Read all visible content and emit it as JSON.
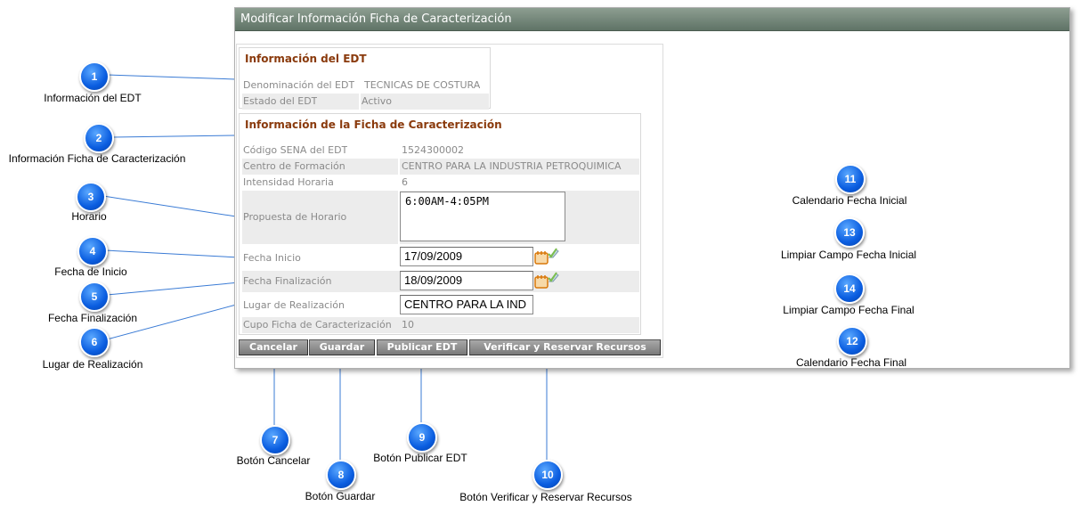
{
  "window": {
    "title": "Modificar Información Ficha de Caracterización"
  },
  "edt_section": {
    "title": "Información del EDT",
    "rows": [
      {
        "label": "Denominación del EDT",
        "value": "TECNICAS DE COSTURA"
      },
      {
        "label": "Estado del EDT",
        "value": "Activo"
      }
    ]
  },
  "ficha_section": {
    "title": "Información de la Ficha de Caracterización",
    "codigo": {
      "label": "Código SENA del EDT",
      "value": "1524300002"
    },
    "centro": {
      "label": "Centro de Formación",
      "value": "CENTRO PARA LA INDUSTRIA PETROQUIMICA"
    },
    "intensidad": {
      "label": "Intensidad Horaria",
      "value": "6"
    },
    "horario": {
      "label": "Propuesta de Horario",
      "value": "6:00AM-4:05PM"
    },
    "fecha_inicio": {
      "label": "Fecha Inicio",
      "value": "17/09/2009"
    },
    "fecha_fin": {
      "label": "Fecha Finalización",
      "value": "18/09/2009"
    },
    "lugar": {
      "label": "Lugar de Realización",
      "value": "CENTRO PARA LA IND"
    },
    "cupo": {
      "label": "Cupo Ficha de Caracterización",
      "value": "10"
    }
  },
  "buttons": {
    "cancelar": "Cancelar",
    "guardar": "Guardar",
    "publicar": "Publicar EDT",
    "verificar": "Verificar y Reservar Recursos"
  },
  "annotations": [
    {
      "num": "1",
      "caption": "Información del EDT"
    },
    {
      "num": "2",
      "caption": "Información Ficha de Caracterización"
    },
    {
      "num": "3",
      "caption": "Horario"
    },
    {
      "num": "4",
      "caption": "Fecha de Inicio"
    },
    {
      "num": "5",
      "caption": "Fecha Finalización"
    },
    {
      "num": "6",
      "caption": "Lugar de Realización"
    },
    {
      "num": "7",
      "caption": "Botón Cancelar"
    },
    {
      "num": "8",
      "caption": "Botón Guardar"
    },
    {
      "num": "9",
      "caption": "Botón Publicar EDT"
    },
    {
      "num": "10",
      "caption": "Botón Verificar y Reservar Recursos"
    },
    {
      "num": "11",
      "caption": "Calendario Fecha Inicial"
    },
    {
      "num": "12",
      "caption": "Calendario Fecha Final"
    },
    {
      "num": "13",
      "caption": "Limpiar Campo Fecha Inicial"
    },
    {
      "num": "14",
      "caption": "Limpiar Campo Fecha Final"
    }
  ],
  "icons": {
    "calendar": "calendar-icon",
    "clear": "clear-field-icon",
    "callout": "numbered-callout-marker"
  },
  "colors": {
    "title_bar": "#6f8275",
    "section_title": "#8a3a0c",
    "callout_blue": "#0a5de0",
    "button_gray": "#8a8a8a"
  }
}
